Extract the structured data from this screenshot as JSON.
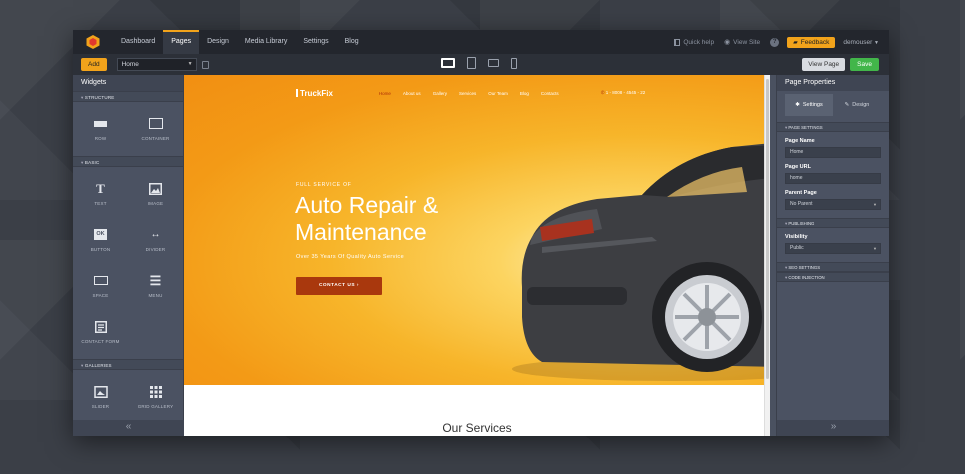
{
  "nav": {
    "items": [
      "Dashboard",
      "Pages",
      "Design",
      "Media Library",
      "Settings",
      "Blog"
    ],
    "active": "Pages",
    "quick_help": "Quick help",
    "view_site": "View Site",
    "help": "?",
    "feedback": "Feedback",
    "user": "demouser"
  },
  "toolbar": {
    "add_label": "Add",
    "page_select": "Home",
    "view_page": "View Page",
    "save": "Save"
  },
  "widgets": {
    "title": "Widgets",
    "sections": [
      {
        "name": "STRUCTURE",
        "items": [
          {
            "label": "ROW",
            "icon": "row-icon"
          },
          {
            "label": "CONTAINER",
            "icon": "container-icon"
          }
        ]
      },
      {
        "name": "BASIC",
        "items": [
          {
            "label": "TEXT",
            "icon": "text-icon"
          },
          {
            "label": "IMAGE",
            "icon": "image-icon"
          },
          {
            "label": "BUTTON",
            "icon": "button-icon"
          },
          {
            "label": "DIVIDER",
            "icon": "divider-icon"
          },
          {
            "label": "SPACE",
            "icon": "space-icon"
          },
          {
            "label": "MENU",
            "icon": "menu-icon"
          },
          {
            "label": "CONTACT FORM",
            "icon": "contact-form-icon"
          }
        ]
      },
      {
        "name": "GALLERIES",
        "items": [
          {
            "label": "SLIDER",
            "icon": "slider-icon"
          },
          {
            "label": "GRID GALLERY",
            "icon": "grid-gallery-icon"
          }
        ]
      }
    ],
    "button_glyph": "OK"
  },
  "site": {
    "brand": "TruckFix",
    "nav": [
      "Home",
      "About us",
      "Gallery",
      "Services",
      "Our Team",
      "Blog",
      "Contacts"
    ],
    "active_nav": "Home",
    "phone": "1 - 8008 - 4545 - 22",
    "kicker": "FULL SERVICE OF",
    "headline": "Auto Repair & Maintenance",
    "subline": "Over 35 Years Of Quality Auto Service",
    "cta": "CONTACT US",
    "services_title": "Our Services"
  },
  "properties": {
    "title": "Page Properties",
    "tabs": [
      "Settings",
      "Design"
    ],
    "sec_page_settings": "PAGE SETTINGS",
    "page_name_label": "Page Name",
    "page_name": "Home",
    "page_url_label": "Page URL",
    "page_url": "home",
    "parent_page_label": "Parent Page",
    "parent_page": "No Parent",
    "sec_publishing": "PUBLISHING",
    "visibility_label": "Visibility",
    "visibility": "Public",
    "sec_seo": "SEO SETTINGS",
    "sec_code": "CODE INJECTION"
  },
  "colors": {
    "accent": "#f2a31b",
    "save": "#42b64a",
    "cta": "#a9380d",
    "panel": "#4b5262",
    "topbar": "#23262d"
  }
}
